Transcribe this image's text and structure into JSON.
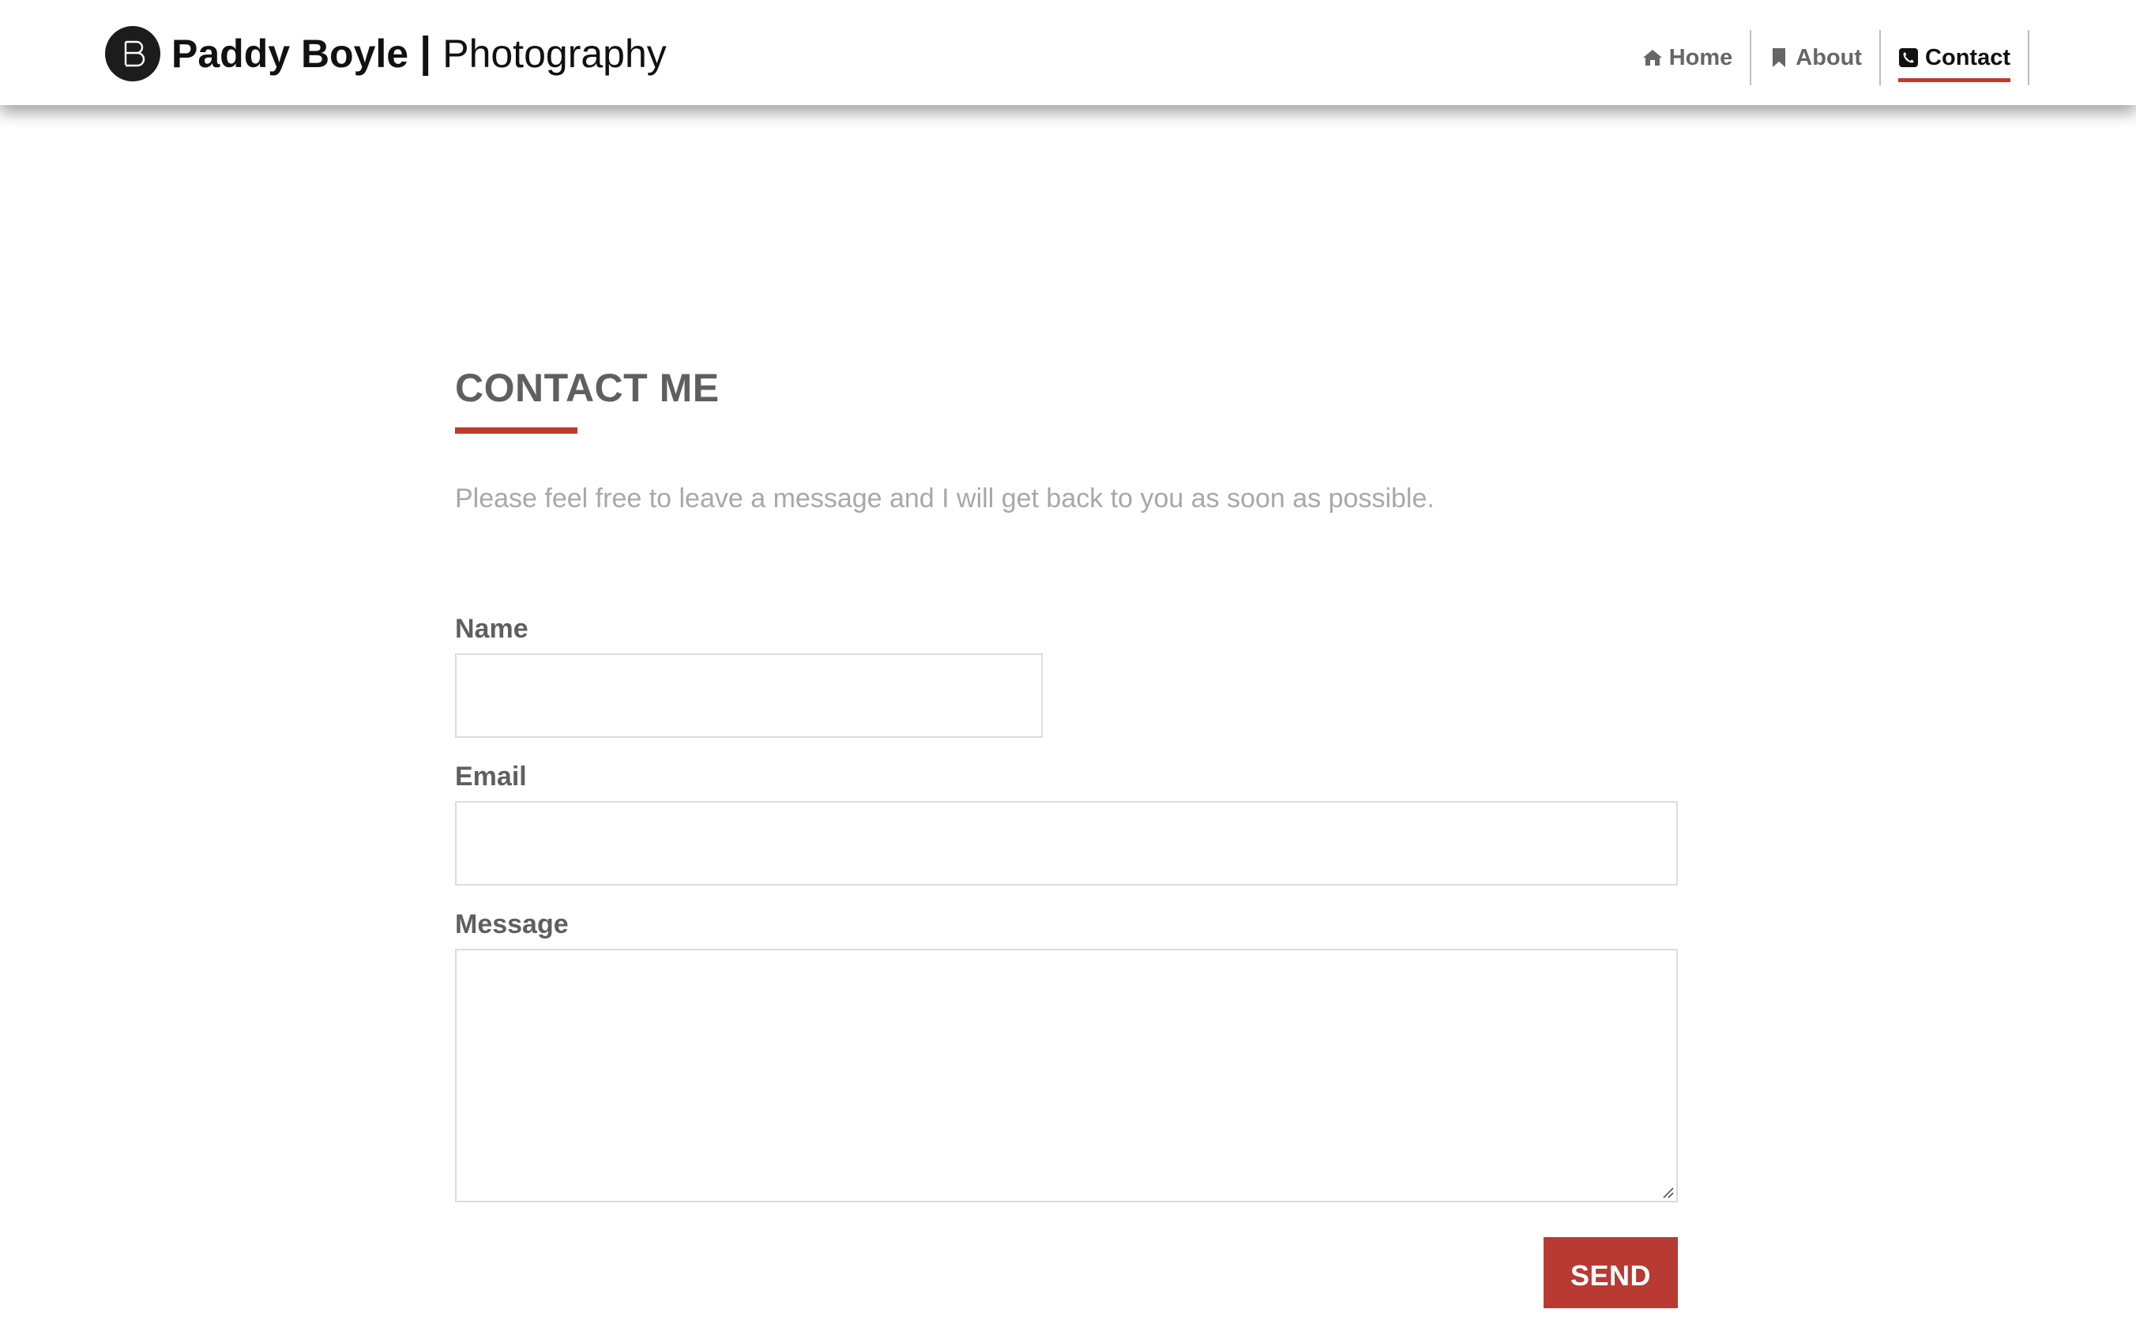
{
  "brand": {
    "name": "Paddy Boyle",
    "separator": "|",
    "subtitle": "Photography"
  },
  "nav": {
    "items": [
      {
        "label": "Home",
        "icon": "home-icon"
      },
      {
        "label": "About",
        "icon": "bookmark-icon"
      },
      {
        "label": "Contact",
        "icon": "phone-icon",
        "active": true
      }
    ]
  },
  "contact": {
    "title": "CONTACT ME",
    "intro": "Please feel free to leave a message and I will get back to you as soon as possible.",
    "form": {
      "name_label": "Name",
      "name_value": "",
      "email_label": "Email",
      "email_value": "",
      "message_label": "Message",
      "message_value": "",
      "send_label": "SEND"
    }
  },
  "colors": {
    "accent": "#c0392b",
    "button": "#b83a33",
    "heading": "#5f5f5f",
    "muted_text": "#a8a8a8"
  }
}
